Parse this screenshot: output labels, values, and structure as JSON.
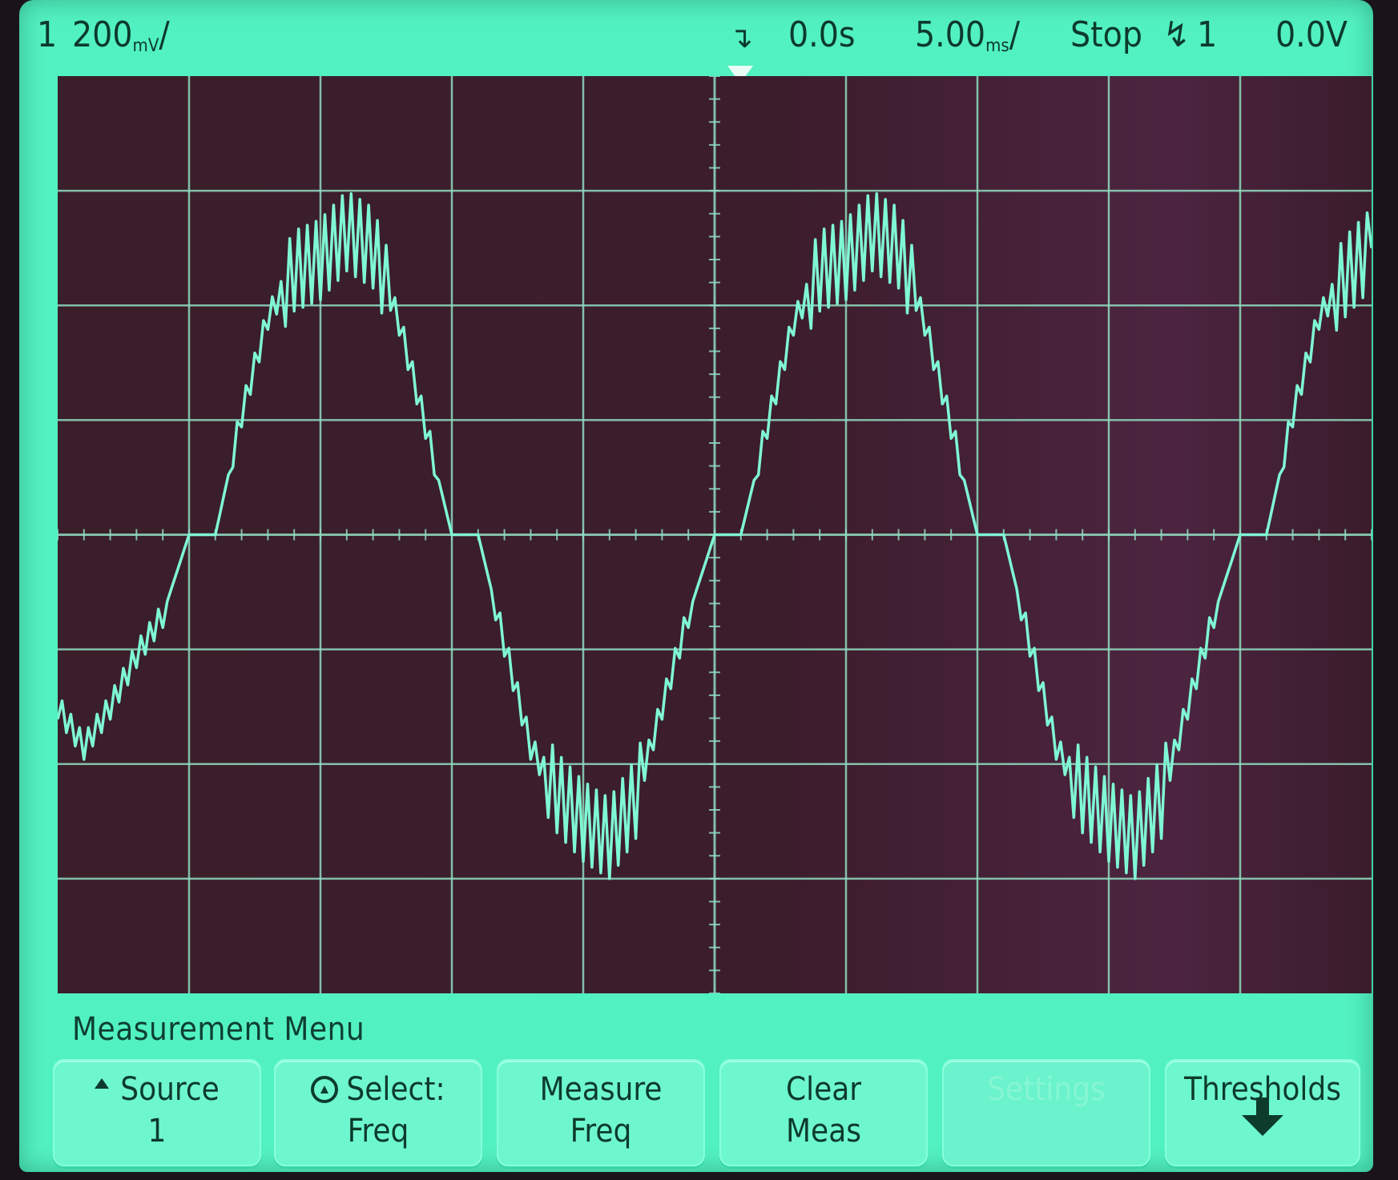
{
  "status": {
    "channel": "1",
    "volts_per_div": "200",
    "volts_unit": "mV",
    "time_offset": "0.0s",
    "time_per_div": "5.00",
    "time_unit": "ms",
    "run_state": "Stop",
    "trigger_channel": "1",
    "trigger_level": "0.0V",
    "trigger_slope_icon": "rising-edge-icon"
  },
  "menu": {
    "title": "Measurement Menu",
    "softkeys": [
      {
        "line1": "Source",
        "line2": "1",
        "icon": "up-triangle-icon",
        "enabled": true
      },
      {
        "line1": "Select:",
        "line2": "Freq",
        "icon": "entry-knob-icon",
        "enabled": true
      },
      {
        "line1": "Measure",
        "line2": "Freq",
        "enabled": true
      },
      {
        "line1": "Clear",
        "line2": "Meas",
        "enabled": true
      },
      {
        "line1": "Settings",
        "line2": "",
        "enabled": false
      },
      {
        "line1": "Thresholds",
        "line2": "",
        "icon": "down-arrow-icon",
        "enabled": true
      }
    ]
  },
  "colors": {
    "phosphor": "#52f1c1",
    "grid_bg": "#3a1e2a",
    "grid_line": "#8fdcc0",
    "trace": "#7ff7d4",
    "text": "#0d3a2c"
  },
  "chart_data": {
    "type": "line",
    "x_divisions": 10,
    "y_divisions": 8,
    "xlim": [
      -25,
      25
    ],
    "xunit": "ms",
    "ylim": [
      -800,
      800
    ],
    "yunit": "mV",
    "grid": true,
    "series": [
      {
        "x": [
          -25,
          -24,
          -23,
          -22,
          -21,
          -20,
          -19,
          -18,
          -17,
          -16,
          -15,
          -14,
          -13,
          -12,
          -11,
          -10,
          -9,
          -8,
          -7,
          -6,
          -5,
          -4,
          -3,
          -2,
          -1,
          0,
          1,
          2,
          3,
          4,
          5,
          6,
          7,
          8,
          9,
          10,
          11,
          12,
          13,
          14,
          15,
          16,
          17,
          18,
          19,
          20,
          21,
          22,
          23,
          24,
          25
        ],
        "y": [
          -300,
          -370,
          -300,
          -210,
          -140,
          0,
          0,
          210,
          380,
          460,
          480,
          530,
          500,
          370,
          190,
          0,
          0,
          -190,
          -370,
          -450,
          -500,
          -530,
          -460,
          -300,
          -140,
          0,
          0,
          190,
          370,
          460,
          480,
          530,
          500,
          370,
          190,
          0,
          0,
          -190,
          -370,
          -450,
          -500,
          -530,
          -460,
          -300,
          -140,
          0,
          0,
          210,
          380,
          450,
          500
        ]
      }
    ]
  }
}
